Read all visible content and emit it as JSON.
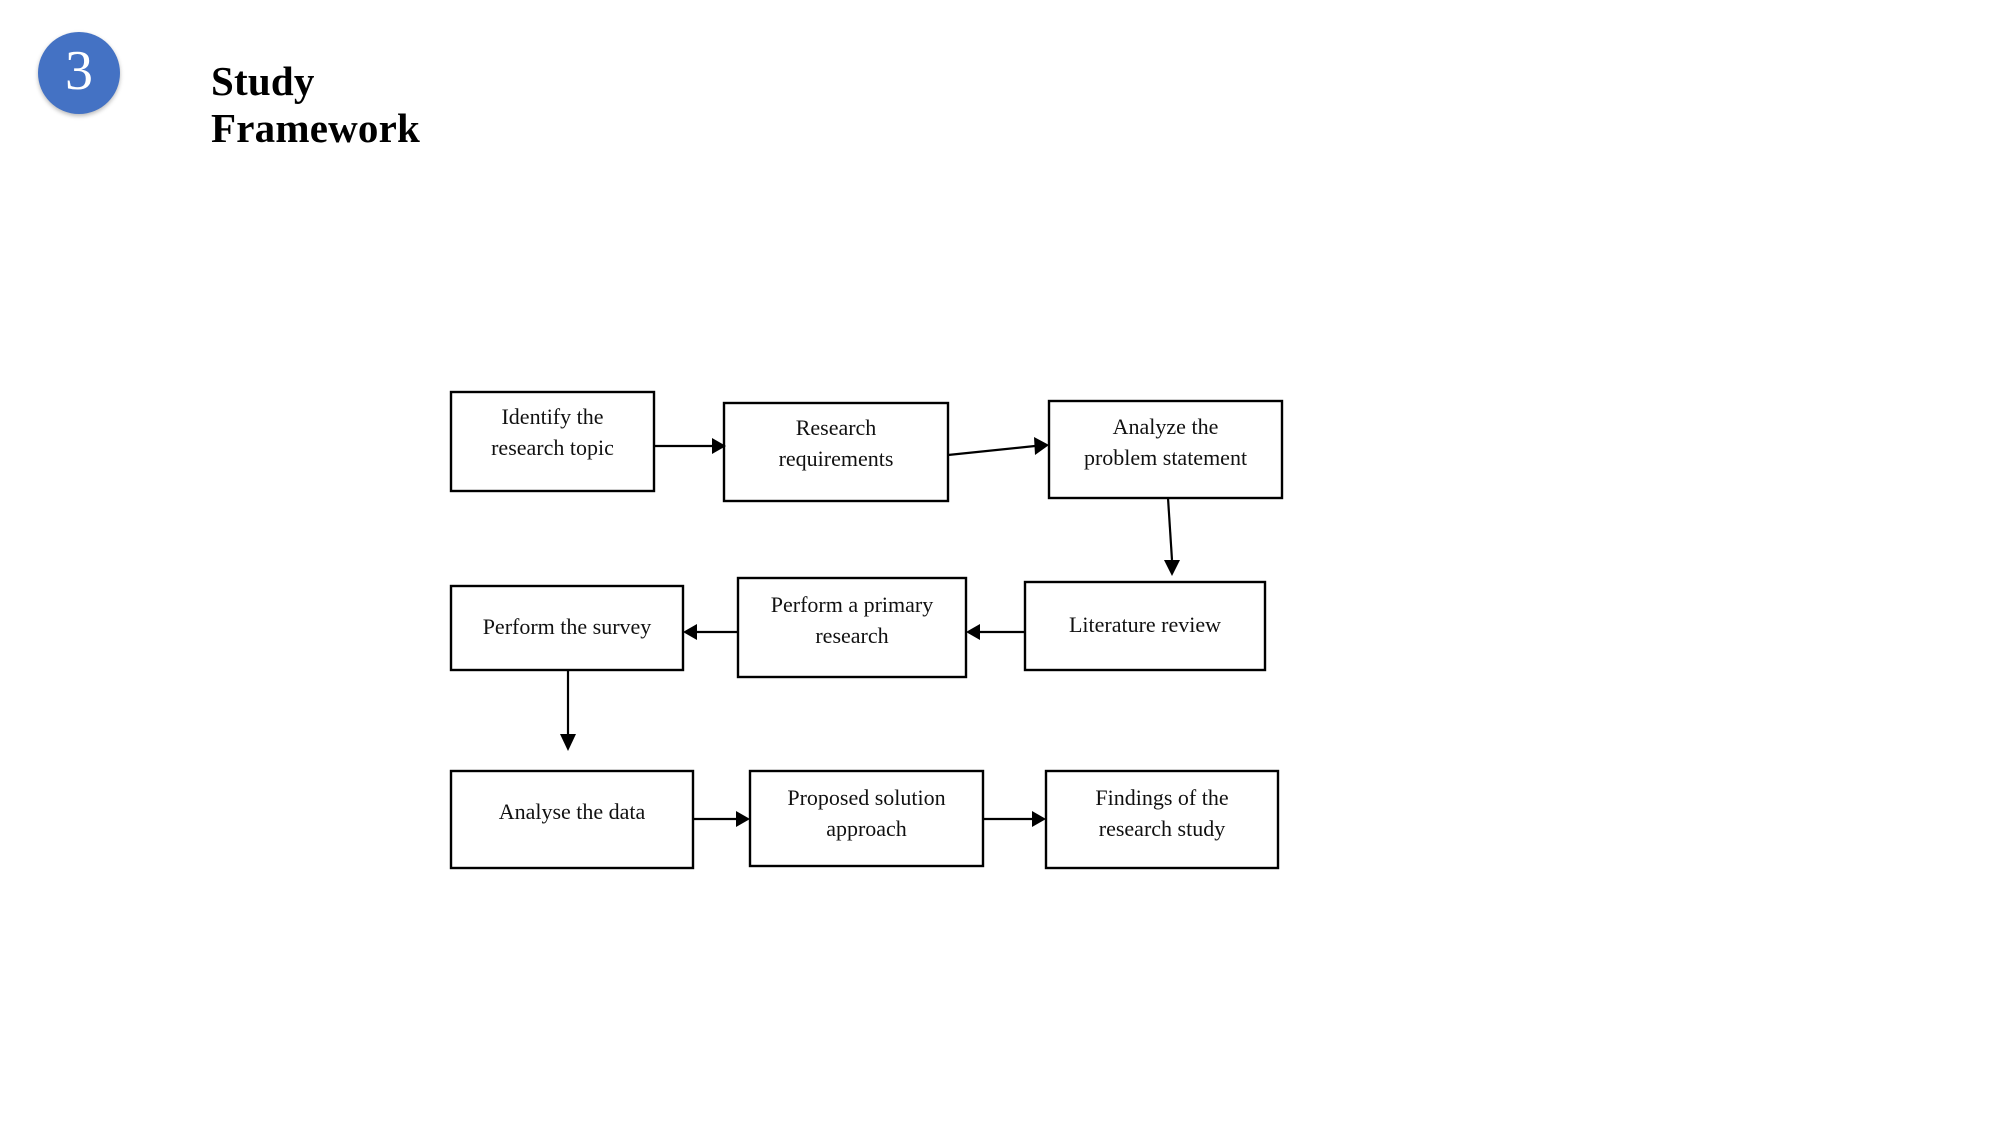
{
  "header": {
    "badge_number": "3",
    "badge_color": "#4472c4",
    "title": "Study\nFramework"
  },
  "diagram": {
    "type": "flowchart",
    "orientation": "serpentine-rows",
    "line_color": "#000000",
    "box_fill": "#ffffff",
    "nodes": [
      {
        "id": "n1",
        "label_line1": "Identify the",
        "label_line2": "research topic",
        "row": 1,
        "col": 1
      },
      {
        "id": "n2",
        "label_line1": "Research",
        "label_line2": "requirements",
        "row": 1,
        "col": 2
      },
      {
        "id": "n3",
        "label_line1": "Analyze the",
        "label_line2": "problem statement",
        "row": 1,
        "col": 3
      },
      {
        "id": "n4",
        "label_line1": "Perform the survey",
        "label_line2": "",
        "row": 2,
        "col": 1
      },
      {
        "id": "n5",
        "label_line1": "Perform a primary",
        "label_line2": "research",
        "row": 2,
        "col": 2
      },
      {
        "id": "n6",
        "label_line1": "Literature review",
        "label_line2": "",
        "row": 2,
        "col": 3
      },
      {
        "id": "n7",
        "label_line1": "Analyse the data",
        "label_line2": "",
        "row": 3,
        "col": 1
      },
      {
        "id": "n8",
        "label_line1": "Proposed solution",
        "label_line2": "approach",
        "row": 3,
        "col": 2
      },
      {
        "id": "n9",
        "label_line1": "Findings of the",
        "label_line2": "research study",
        "row": 3,
        "col": 3
      }
    ],
    "edges": [
      {
        "from": "n1",
        "to": "n2",
        "direction": "right"
      },
      {
        "from": "n2",
        "to": "n3",
        "direction": "right"
      },
      {
        "from": "n3",
        "to": "n6",
        "direction": "down"
      },
      {
        "from": "n6",
        "to": "n5",
        "direction": "left"
      },
      {
        "from": "n5",
        "to": "n4",
        "direction": "left"
      },
      {
        "from": "n4",
        "to": "n7",
        "direction": "down"
      },
      {
        "from": "n7",
        "to": "n8",
        "direction": "right"
      },
      {
        "from": "n8",
        "to": "n9",
        "direction": "right"
      }
    ]
  }
}
